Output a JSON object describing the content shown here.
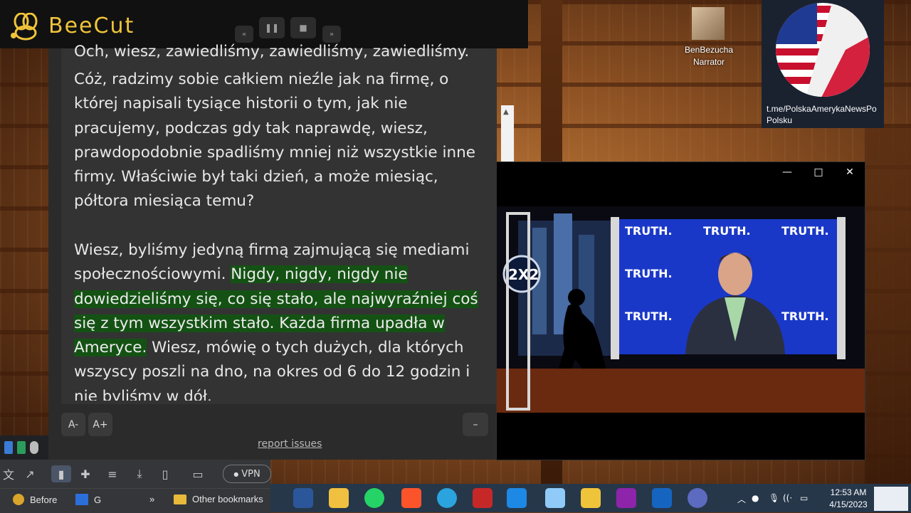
{
  "beecut": {
    "app_name": "BeeCut",
    "rewind": "«",
    "pause": "❚❚",
    "stop": "■",
    "forward": "»"
  },
  "transcript": {
    "top_partial": "Och, wiesz, zawiedliśmy, zawiedliśmy, zawiedliśmy.",
    "para1": "Cóż, radzimy sobie całkiem nieźle jak na firmę, o której napisali tysiące historii o tym, jak nie pracujemy, podczas gdy tak naprawdę, wiesz, prawdopodobnie spadliśmy mniej niż wszystkie inne firmy. Właściwie był taki dzień, a może miesiąc, półtora miesiąca temu?",
    "para2_start": "Wiesz, byliśmy jedyną firmą zajmującą się mediami społecznościowymi.",
    "para2_highlight": "Nigdy, nigdy, nigdy nie dowiedzieliśmy się, co się stało, ale najwyraźniej coś się z tym wszystkim stało. Każda firma upadła w Ameryce.",
    "para2_end": "Wiesz, mówię o tych dużych, dla których wszyscy poszli na dno, na okres od 6 do 12 godzin i nie byliśmy w dół.",
    "font_smaller": "A-",
    "font_larger": "A+",
    "collapse": "–",
    "report": "report issues"
  },
  "browser": {
    "vpn_label": "VPN",
    "bookmarks": [
      {
        "label": "Before"
      },
      {
        "label": "G"
      },
      {
        "label": "»"
      },
      {
        "label": "Other bookmarks"
      }
    ]
  },
  "desktop": {
    "narrator_label": "BenBezucha Narrator",
    "flag_label": "t.me/PolskaAmerykaNewsPo Polsku"
  },
  "video": {
    "minimize": "—",
    "maximize": "□",
    "close": "✕",
    "wall_text": "TRUTH.",
    "logo_text": "2X2"
  },
  "taskbar": {
    "time": "12:53 AM",
    "date": "4/15/2023"
  },
  "colors": {
    "highlight": "#145214",
    "beecut_yellow": "#f0c43a",
    "taskbar": "#26374a"
  }
}
